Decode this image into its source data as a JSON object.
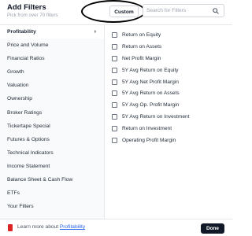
{
  "header": {
    "title": "Add Filters",
    "subtitle": "Pick from over 70 filters",
    "custom_label": "Custom",
    "search_placeholder": "Search for Filters",
    "search_icon": "search-icon"
  },
  "sidebar": {
    "items": [
      {
        "label": "Profitability",
        "active": true
      },
      {
        "label": "Price and Volume"
      },
      {
        "label": "Financial Ratios"
      },
      {
        "label": "Growth"
      },
      {
        "label": "Valuation"
      },
      {
        "label": "Ownership"
      },
      {
        "label": "Broker Ratings"
      },
      {
        "label": "Tickertape Special"
      },
      {
        "label": "Futures & Options"
      },
      {
        "label": "Technical Indicators"
      },
      {
        "label": "Income Statement"
      },
      {
        "label": "Balance Sheet & Cash Flow"
      },
      {
        "label": "ETFs"
      },
      {
        "label": "Your Filters"
      }
    ],
    "active_chevron": "›"
  },
  "options": [
    {
      "label": "Return on Equity",
      "checked": false
    },
    {
      "label": "Return on Assets",
      "checked": false
    },
    {
      "label": "Net Profit Margin",
      "checked": false
    },
    {
      "label": "5Y Avg Return on Equity",
      "checked": false
    },
    {
      "label": "5Y Avg Net Profit Margin",
      "checked": false
    },
    {
      "label": "5Y Avg Return on Assets",
      "checked": false
    },
    {
      "label": "5Y Avg Op. Profit Margin",
      "checked": false
    },
    {
      "label": "5Y Avg Return on Investment",
      "checked": false
    },
    {
      "label": "Return on Investment",
      "checked": false
    },
    {
      "label": "Operating Profit Margin",
      "checked": false
    }
  ],
  "footer": {
    "learn_prefix": "Learn more about ",
    "learn_link": "Profitability",
    "done_label": "Done",
    "book_icon": "book-icon"
  },
  "colors": {
    "accent": "#111827",
    "link": "#2563eb",
    "book": "#dc2626"
  }
}
